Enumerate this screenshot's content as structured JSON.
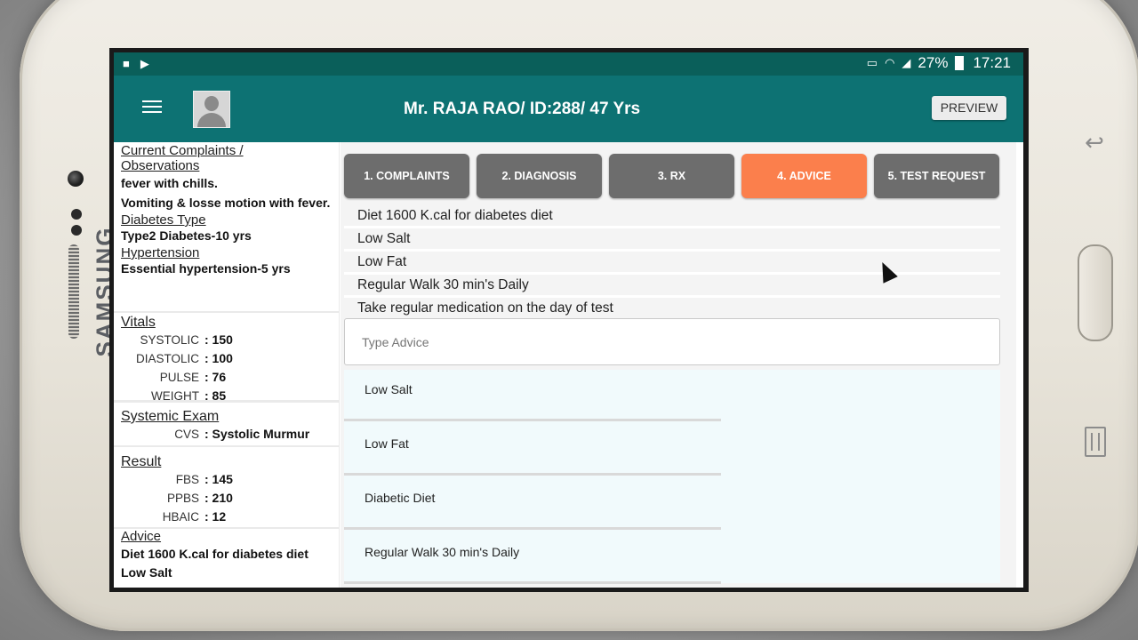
{
  "device": {
    "brand": "SAMSUNG"
  },
  "status_bar": {
    "left_icons": [
      "video-icon",
      "play-store-icon"
    ],
    "right_icons": [
      "cast-icon",
      "wifi-icon",
      "signal-icon"
    ],
    "battery": "27%",
    "time": "17:21"
  },
  "app_bar": {
    "title": "Mr. RAJA RAO/ ID:288/ 47 Yrs",
    "preview_label": "PREVIEW",
    "menu_icon": "hamburger-icon",
    "avatar_icon": "person-avatar-icon"
  },
  "summary": {
    "complaints_heading": "Current Complaints / Observations",
    "complaints": [
      "fever  with chills.",
      "Vomiting & losse motion with fever."
    ],
    "diabetes_heading": "Diabetes Type",
    "diabetes_value": "Type2  Diabetes-10 yrs",
    "hypertension_heading": "Hypertension",
    "hypertension_value": "Essential hypertension-5 yrs",
    "vitals_heading": "Vitals",
    "vitals": [
      {
        "label": "SYSTOLIC",
        "value": ": 150"
      },
      {
        "label": "DIASTOLIC",
        "value": ": 100"
      },
      {
        "label": "PULSE",
        "value": ": 76"
      },
      {
        "label": "WEIGHT",
        "value": ": 85"
      }
    ],
    "systemic_heading": "Systemic Exam",
    "systemic": [
      {
        "label": "CVS",
        "value": ": Systolic Murmur"
      }
    ],
    "result_heading": "Result",
    "results": [
      {
        "label": "FBS",
        "value": ": 145"
      },
      {
        "label": "PPBS",
        "value": ": 210"
      },
      {
        "label": "HBAIC",
        "value": ": 12"
      }
    ],
    "advice_heading": "Advice",
    "advice": [
      "Diet 1600 K.cal for diabetes diet",
      "Low Salt"
    ]
  },
  "tabs": [
    {
      "label": "1. COMPLAINTS",
      "active": false
    },
    {
      "label": "2. DIAGNOSIS",
      "active": false
    },
    {
      "label": "3. RX",
      "active": false
    },
    {
      "label": "4. ADVICE",
      "active": true
    },
    {
      "label": "5. TEST REQUEST",
      "active": false
    }
  ],
  "advice_list": [
    "Diet 1600 K.cal for diabetes diet",
    "Low Salt",
    "Low Fat",
    "Regular Walk 30 min's Daily",
    "Take regular medication on the day of test"
  ],
  "advice_input": {
    "placeholder": "Type Advice"
  },
  "suggestions": [
    "Low Salt",
    "Low Fat",
    "Diabetic Diet",
    "Regular Walk 30 min's Daily"
  ],
  "colors": {
    "status_bar": "#0a5f5a",
    "app_bar": "#0d7273",
    "tab_default": "#6d6d6d",
    "tab_active": "#fb7f4c"
  }
}
